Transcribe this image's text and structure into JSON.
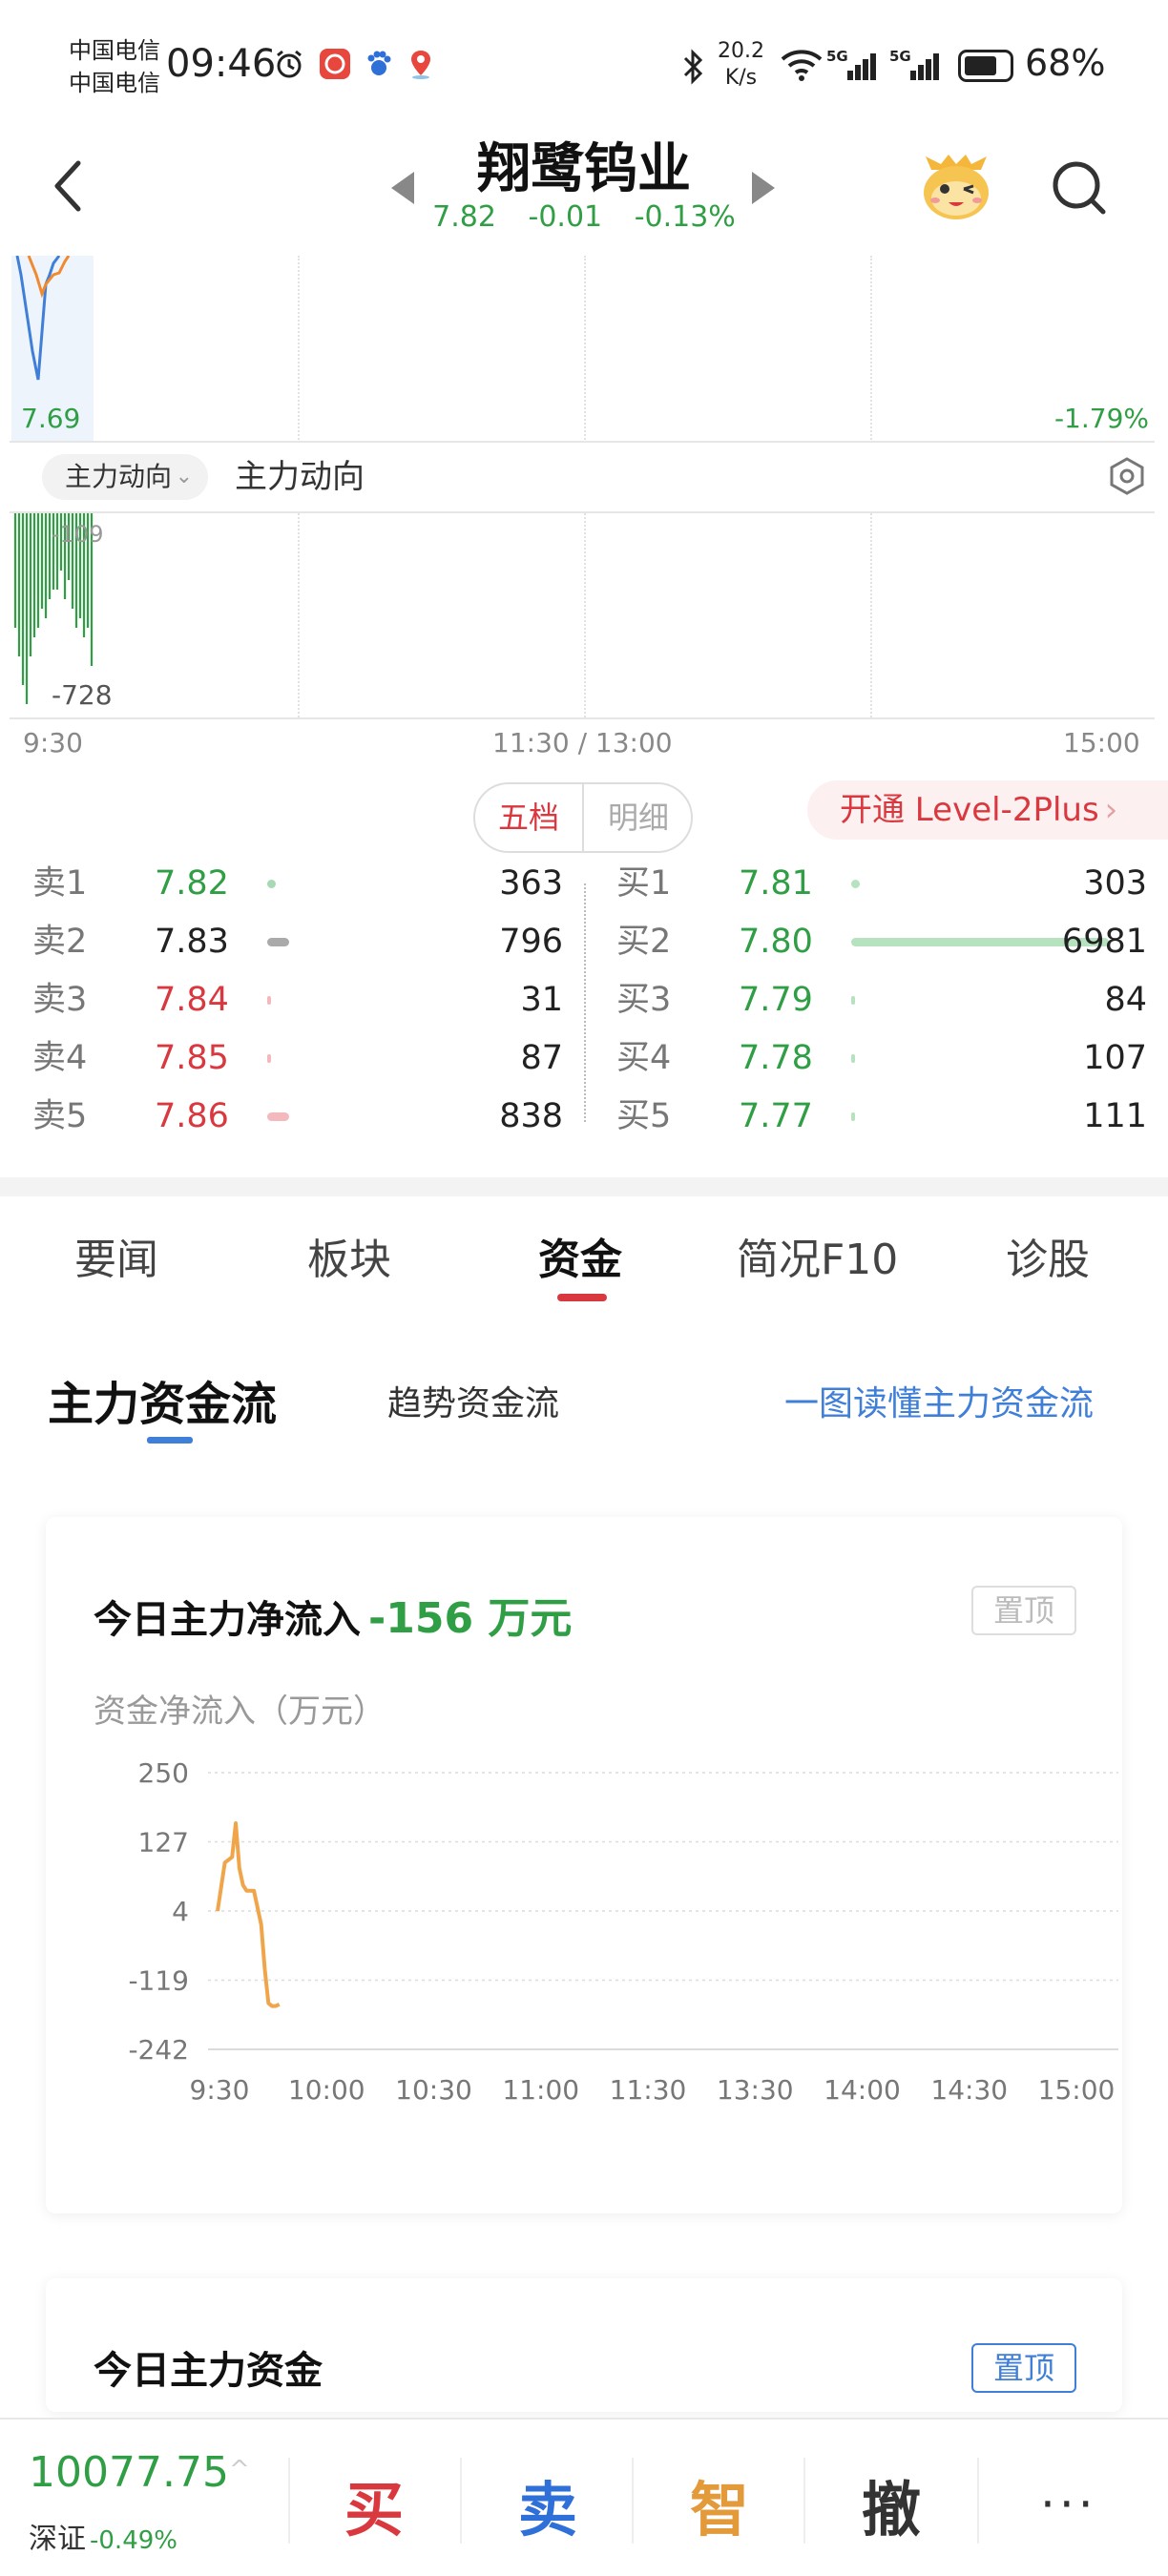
{
  "status_bar": {
    "carrier_1": "中国电信",
    "carrier_2": "中国电信",
    "time": "09:46",
    "net_speed_value": "20.2",
    "net_speed_unit": "K/s",
    "signal_1": "5G",
    "signal_2": "5G",
    "battery": "68%",
    "icons": [
      "alarm-icon",
      "app-notification-icon",
      "baidu-icon",
      "map-pin-icon",
      "bluetooth-icon",
      "wifi-icon"
    ]
  },
  "header": {
    "stock_name": "翔鹭钨业",
    "price": "7.82",
    "change": "-0.01",
    "change_pct": "-0.13%"
  },
  "price_chart": {
    "low_label": "7.69",
    "low_pct": "-1.79%"
  },
  "indicator": {
    "dropdown_label": "主力动向",
    "title": "主力动向",
    "value_label_top": "-109",
    "value_label_bottom": "-728"
  },
  "time_axis": {
    "start": "9:30",
    "mid": "11:30 / 13:00",
    "end": "15:00"
  },
  "order_book": {
    "tab_active": "五档",
    "tab_inactive": "明细",
    "level2_banner": "开通 Level-2Plus",
    "level2_arrow": "›",
    "sell": [
      {
        "label": "卖1",
        "price": "7.82",
        "volume": "363",
        "color": "#2f9e44",
        "fraction": 0.02
      },
      {
        "label": "卖2",
        "price": "7.83",
        "volume": "796",
        "color": "#222222",
        "fraction": 0.05
      },
      {
        "label": "卖3",
        "price": "7.84",
        "volume": "31",
        "color": "#d9383f",
        "fraction": 0.005
      },
      {
        "label": "卖4",
        "price": "7.85",
        "volume": "87",
        "color": "#d9383f",
        "fraction": 0.005
      },
      {
        "label": "卖5",
        "price": "7.86",
        "volume": "838",
        "color": "#d9383f",
        "fraction": 0.05
      }
    ],
    "buy": [
      {
        "label": "买1",
        "price": "7.81",
        "volume": "303",
        "color": "#2f9e44",
        "fraction": 0.02
      },
      {
        "label": "买2",
        "price": "7.80",
        "volume": "6981",
        "color": "#2f9e44",
        "fraction": 0.6
      },
      {
        "label": "买3",
        "price": "7.79",
        "volume": "84",
        "color": "#2f9e44",
        "fraction": 0.005
      },
      {
        "label": "买4",
        "price": "7.78",
        "volume": "107",
        "color": "#2f9e44",
        "fraction": 0.005
      },
      {
        "label": "买5",
        "price": "7.77",
        "volume": "111",
        "color": "#2f9e44",
        "fraction": 0.005
      }
    ]
  },
  "tabs": {
    "items": [
      "要闻",
      "板块",
      "资金",
      "简况F10",
      "诊股"
    ],
    "active_index": 2
  },
  "subtabs": {
    "main": "主力资金流",
    "trend": "趋势资金流",
    "guide_link": "一图读懂主力资金流"
  },
  "flow_card": {
    "title": "今日主力净流入",
    "value": "-156 万元",
    "pin_label": "置顶",
    "chart_title": "资金净流入（万元）"
  },
  "chart_data": {
    "type": "line",
    "title": "资金净流入（万元）",
    "xlabel": "",
    "ylabel": "",
    "x_ticks": [
      "9:30",
      "10:00",
      "10:30",
      "11:00",
      "11:30",
      "13:30",
      "14:00",
      "14:30",
      "15:00"
    ],
    "y_ticks": [
      250,
      127,
      4,
      -119,
      -242
    ],
    "ylim": [
      -242,
      250
    ],
    "grid": true,
    "series": [
      {
        "color": "#f0a54a",
        "x_minutes": [
          0,
          2,
          4,
          5,
          6,
          7,
          8,
          10,
          12,
          13,
          14,
          15,
          16,
          17
        ],
        "values": [
          4,
          90,
          100,
          160,
          80,
          50,
          40,
          40,
          -20,
          -100,
          -160,
          -165,
          -165,
          -162
        ]
      }
    ]
  },
  "flow_card2": {
    "title": "今日主力资金",
    "pin_label": "置顶"
  },
  "bottom_bar": {
    "index_value": "10077.75",
    "index_chevron": "^",
    "index_name": "深证",
    "index_change": "-0.49%",
    "buy": "买",
    "sell": "卖",
    "smart": "智",
    "cancel": "撤",
    "more": "···",
    "colors": {
      "buy": "#d9383f",
      "sell": "#2f6fd8",
      "smart": "#e39a3b",
      "cancel": "#333333"
    }
  }
}
